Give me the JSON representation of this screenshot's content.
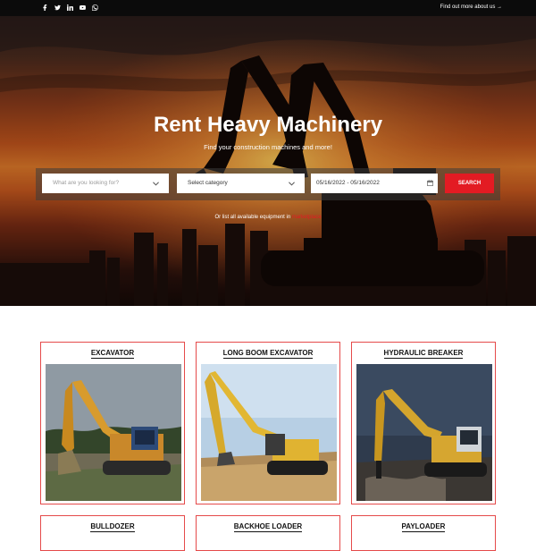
{
  "topbar": {
    "social_icons": [
      "facebook-icon",
      "twitter-icon",
      "linkedin-icon",
      "youtube-icon",
      "whatsapp-icon"
    ],
    "link_text": "Find out more about us →"
  },
  "hero": {
    "title": "Rent Heavy Machinery",
    "subtitle": "Find your construction machines and more!",
    "search": {
      "query_placeholder": "What are you looking for?",
      "category_value": "Select category",
      "date_range": "05/16/2022 - 05/16/2022",
      "button_label": "SEARCH"
    },
    "list_prefix": "Or list all available equipment in ",
    "list_link": "marketplace"
  },
  "cards": [
    {
      "title": "EXCAVATOR"
    },
    {
      "title": "LONG BOOM EXCAVATOR"
    },
    {
      "title": "HYDRAULIC BREAKER"
    },
    {
      "title": "BULLDOZER"
    },
    {
      "title": "BACKHOE LOADER"
    },
    {
      "title": "PAYLOADER"
    }
  ],
  "colors": {
    "accent": "#e31b23",
    "topbar": "#0b0b0b",
    "card_border": "#e54a4a"
  }
}
